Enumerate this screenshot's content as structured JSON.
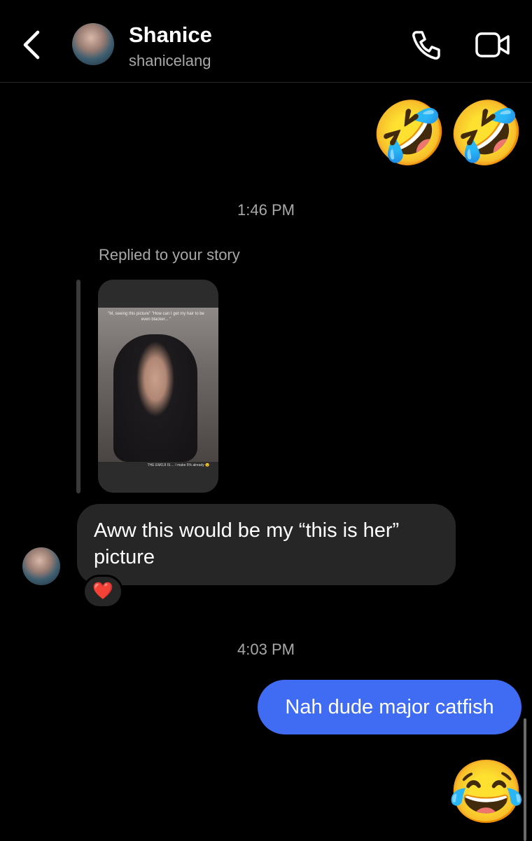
{
  "header": {
    "name": "Shanice",
    "username": "shanicelang"
  },
  "messages": {
    "emoji_top_1": "🤣",
    "emoji_top_2": "🤣",
    "time_1": "1:46 PM",
    "reply_label": "Replied to your story",
    "story_caption_top": "\"M, seeing this picture\" \"How can I get my hair to be even blacker... \"",
    "story_caption_bottom": "THE EMOJI IS ... I make 5% already 😉",
    "incoming_text": "Aww this would be my “this is her” picture",
    "reaction": "❤️",
    "time_2": "4:03 PM",
    "outgoing_text": "Nah dude major catfish",
    "emoji_bottom": "😂"
  },
  "colors": {
    "background": "#000000",
    "incoming_bubble": "#262626",
    "outgoing_bubble": "#3f6cf2",
    "secondary_text": "#a8a8a8"
  },
  "icons": [
    "chevron-left-icon",
    "phone-icon",
    "video-camera-icon"
  ]
}
